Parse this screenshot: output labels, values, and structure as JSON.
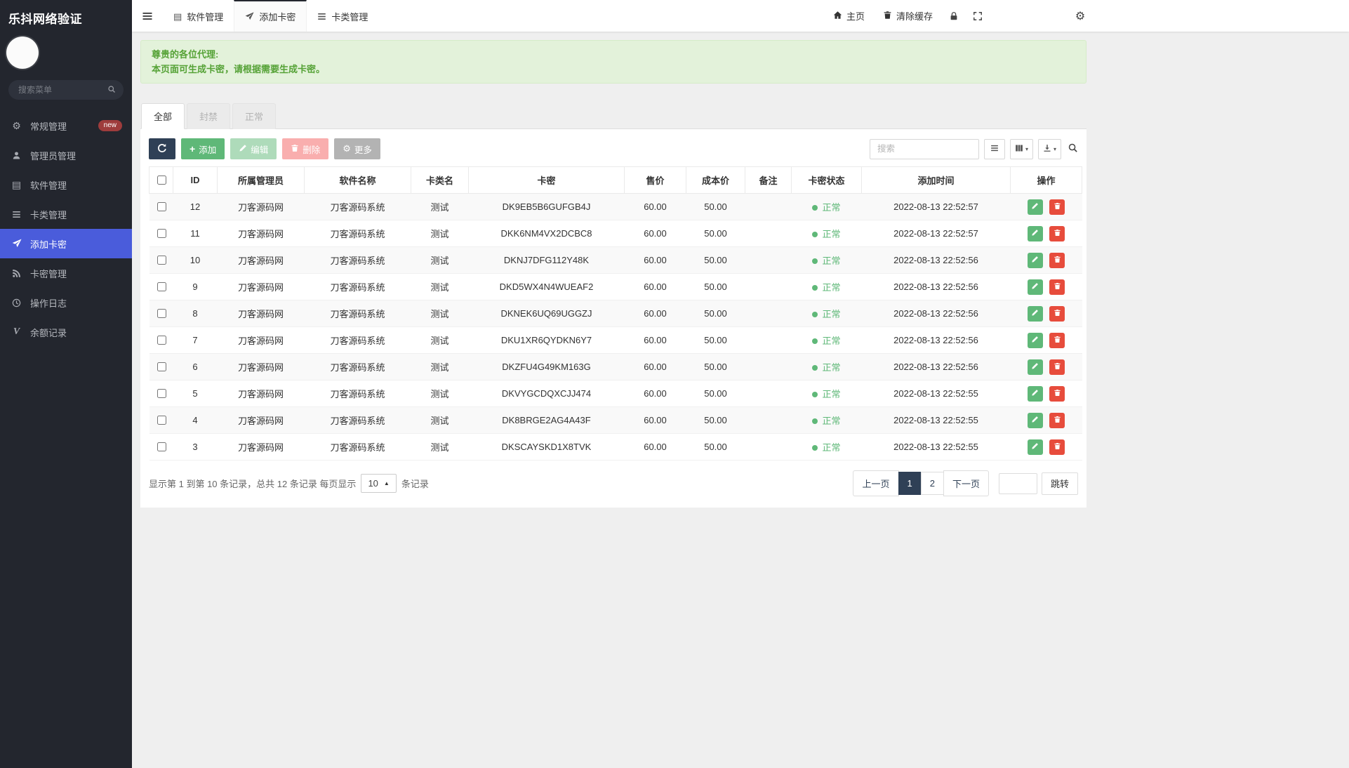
{
  "app": {
    "title": "乐抖网络验证"
  },
  "colors": {
    "sidebar_bg": "#23262e",
    "sidebar_active": "#4a5cdb",
    "primary_dark": "#2f4056",
    "success_green": "#5fb878",
    "danger_red": "#e74c3c",
    "disabled_red": "#f56c6c",
    "alert_bg": "#e3f2da",
    "alert_text": "#55a236",
    "badge_red": "#9e3c3c"
  },
  "icons": {
    "gear": "⚙",
    "list": "▤",
    "plus": "+",
    "caret_down": "▾",
    "caret_up": "▲",
    "balance": "V"
  },
  "sidebar": {
    "search_placeholder": "搜索菜单",
    "items": [
      {
        "label": "常规管理",
        "badge": "new"
      },
      {
        "label": "管理员管理"
      },
      {
        "label": "软件管理"
      },
      {
        "label": "卡类管理"
      },
      {
        "label": "添加卡密"
      },
      {
        "label": "卡密管理"
      },
      {
        "label": "操作日志"
      },
      {
        "label": "余额记录"
      }
    ]
  },
  "navbar": {
    "tabs": [
      {
        "label": "软件管理"
      },
      {
        "label": "添加卡密"
      },
      {
        "label": "卡类管理"
      }
    ],
    "home": "主页",
    "clear_cache": "清除缓存"
  },
  "alert": {
    "line1": "尊贵的各位代理:",
    "line2": "本页面可生成卡密，请根据需要生成卡密。"
  },
  "status_tabs": [
    {
      "label": "全部"
    },
    {
      "label": "封禁"
    },
    {
      "label": "正常"
    }
  ],
  "toolbar": {
    "add": "添加",
    "edit": "编辑",
    "delete": "删除",
    "more": "更多",
    "search_placeholder": "搜索"
  },
  "table": {
    "headers": [
      "ID",
      "所属管理员",
      "软件名称",
      "卡类名",
      "卡密",
      "售价",
      "成本价",
      "备注",
      "卡密状态",
      "添加时间",
      "操作"
    ],
    "rows": [
      {
        "id": "12",
        "admin": "刀客源码网",
        "software": "刀客源码系统",
        "type": "测试",
        "key": "DK9EB5B6GUFGB4J",
        "price": "60.00",
        "cost": "50.00",
        "remark": "",
        "status": "正常",
        "time": "2022-08-13 22:52:57"
      },
      {
        "id": "11",
        "admin": "刀客源码网",
        "software": "刀客源码系统",
        "type": "测试",
        "key": "DKK6NM4VX2DCBC8",
        "price": "60.00",
        "cost": "50.00",
        "remark": "",
        "status": "正常",
        "time": "2022-08-13 22:52:57"
      },
      {
        "id": "10",
        "admin": "刀客源码网",
        "software": "刀客源码系统",
        "type": "测试",
        "key": "DKNJ7DFG112Y48K",
        "price": "60.00",
        "cost": "50.00",
        "remark": "",
        "status": "正常",
        "time": "2022-08-13 22:52:56"
      },
      {
        "id": "9",
        "admin": "刀客源码网",
        "software": "刀客源码系统",
        "type": "测试",
        "key": "DKD5WX4N4WUEAF2",
        "price": "60.00",
        "cost": "50.00",
        "remark": "",
        "status": "正常",
        "time": "2022-08-13 22:52:56"
      },
      {
        "id": "8",
        "admin": "刀客源码网",
        "software": "刀客源码系统",
        "type": "测试",
        "key": "DKNEK6UQ69UGGZJ",
        "price": "60.00",
        "cost": "50.00",
        "remark": "",
        "status": "正常",
        "time": "2022-08-13 22:52:56"
      },
      {
        "id": "7",
        "admin": "刀客源码网",
        "software": "刀客源码系统",
        "type": "测试",
        "key": "DKU1XR6QYDKN6Y7",
        "price": "60.00",
        "cost": "50.00",
        "remark": "",
        "status": "正常",
        "time": "2022-08-13 22:52:56"
      },
      {
        "id": "6",
        "admin": "刀客源码网",
        "software": "刀客源码系统",
        "type": "测试",
        "key": "DKZFU4G49KM163G",
        "price": "60.00",
        "cost": "50.00",
        "remark": "",
        "status": "正常",
        "time": "2022-08-13 22:52:56"
      },
      {
        "id": "5",
        "admin": "刀客源码网",
        "software": "刀客源码系统",
        "type": "测试",
        "key": "DKVYGCDQXCJJ474",
        "price": "60.00",
        "cost": "50.00",
        "remark": "",
        "status": "正常",
        "time": "2022-08-13 22:52:55"
      },
      {
        "id": "4",
        "admin": "刀客源码网",
        "software": "刀客源码系统",
        "type": "测试",
        "key": "DK8BRGE2AG4A43F",
        "price": "60.00",
        "cost": "50.00",
        "remark": "",
        "status": "正常",
        "time": "2022-08-13 22:52:55"
      },
      {
        "id": "3",
        "admin": "刀客源码网",
        "software": "刀客源码系统",
        "type": "测试",
        "key": "DKSCAYSKD1X8TVK",
        "price": "60.00",
        "cost": "50.00",
        "remark": "",
        "status": "正常",
        "time": "2022-08-13 22:52:55"
      }
    ]
  },
  "pagination": {
    "summary_before": "显示第 1 到第 10 条记录，总共 12 条记录 每页显示",
    "page_size": "10",
    "summary_after": "条记录",
    "prev": "上一页",
    "pages": [
      "1",
      "2"
    ],
    "active_page": "1",
    "next": "下一页",
    "jump": "跳转"
  }
}
